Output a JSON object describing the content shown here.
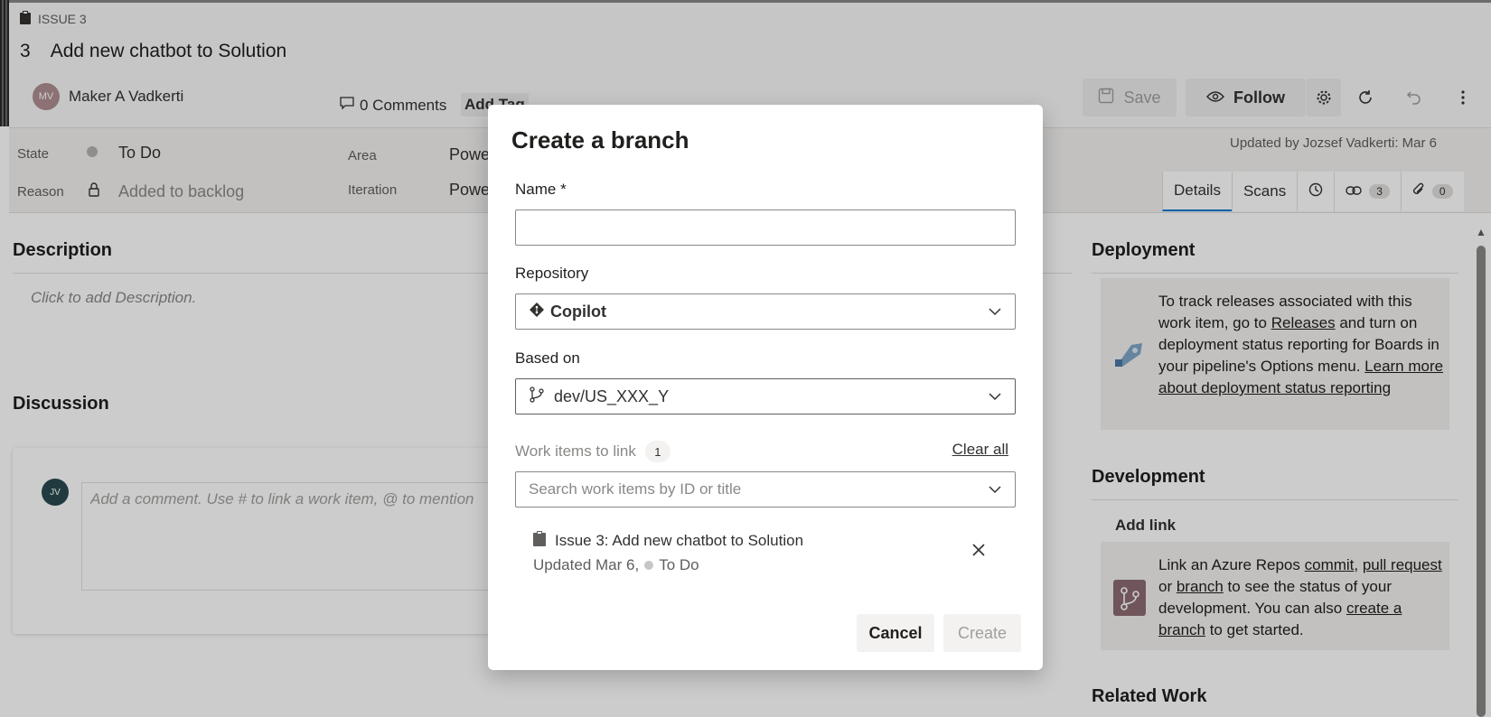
{
  "work_item": {
    "type_label": "ISSUE 3",
    "id": "3",
    "title": "Add new chatbot to Solution",
    "author": "Maker A Vadkerti",
    "author_initials": "MV",
    "comments": "0 Comments",
    "add_tag": "Add Tag"
  },
  "toolbar": {
    "save_label": "Save",
    "follow_label": "Follow"
  },
  "fields": {
    "state_label": "State",
    "state_value": "To Do",
    "reason_label": "Reason",
    "reason_value": "Added to backlog",
    "area_label": "Area",
    "area_value": "Powe",
    "iteration_label": "Iteration",
    "iteration_value": "Powe",
    "updated_by": "Updated by Jozsef Vadkerti: Mar 6"
  },
  "tabs": {
    "details": "Details",
    "scans": "Scans",
    "links_count": "3",
    "attachments_count": "0"
  },
  "description": {
    "title": "Description",
    "placeholder": "Click to add Description."
  },
  "discussion": {
    "title": "Discussion",
    "avatar_initials": "JV",
    "placeholder": "Add a comment. Use # to link a work item, @ to mention"
  },
  "deployment": {
    "title": "Deployment",
    "text_1": "To track releases associated with this work item, go to ",
    "releases_link": "Releases",
    "text_2": " and turn on deployment status reporting for Boards in your pipeline's Options menu. ",
    "learn_link": "Learn more about deployment status reporting"
  },
  "development": {
    "title": "Development",
    "add_link": "Add link",
    "text_1": "Link an Azure Repos ",
    "commit_link": "commit",
    "sep_1": ", ",
    "pr_link": "pull request",
    "text_2": " or ",
    "branch_link": "branch",
    "text_3": " to see the status of your development. You can also ",
    "create_link": "create a branch",
    "text_4": " to get started."
  },
  "related_work": {
    "title": "Related Work"
  },
  "dialog": {
    "title": "Create a branch",
    "name_label": "Name *",
    "name_value": "",
    "repository_label": "Repository",
    "repository_value": "Copilot",
    "based_on_label": "Based on",
    "based_on_value": "dev/US_XXX_Y",
    "work_items_label": "Work items to link",
    "work_items_count": "1",
    "clear_all": "Clear all",
    "search_placeholder": "Search work items by ID or title",
    "linked_item_title": "Issue 3: Add new chatbot to Solution",
    "linked_item_updated": "Updated Mar 6,",
    "linked_item_state": "To Do",
    "cancel_label": "Cancel",
    "create_label": "Create"
  },
  "colors": {
    "accent": "#0078d4",
    "overlay": "#000000",
    "text": "#323130"
  }
}
